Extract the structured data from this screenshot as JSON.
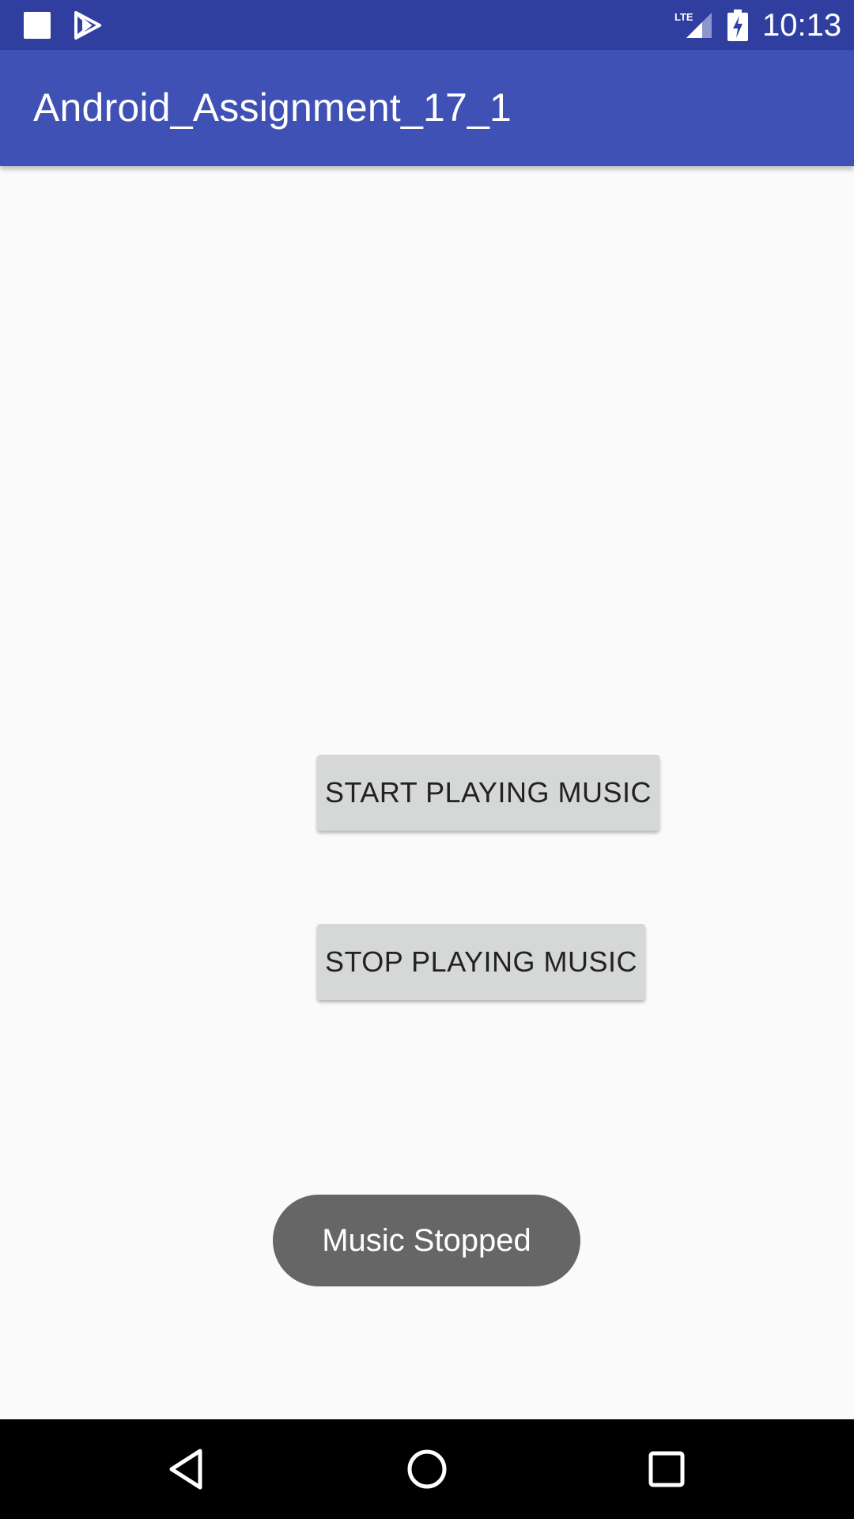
{
  "status_bar": {
    "time": "10:13",
    "network": "LTE",
    "icons": [
      "notification-square-icon",
      "play-store-icon",
      "lte-signal-icon",
      "battery-charging-icon"
    ]
  },
  "app_bar": {
    "title": "Android_Assignment_17_1",
    "color": "#3f51b5",
    "status_color": "#303f9f"
  },
  "main": {
    "buttons": [
      {
        "label": "START PLAYING MUSIC"
      },
      {
        "label": "STOP PLAYING MUSIC"
      }
    ]
  },
  "toast": {
    "message": "Music Stopped"
  },
  "nav_bar": {
    "icons": [
      "back-icon",
      "home-icon",
      "recent-apps-icon"
    ]
  }
}
